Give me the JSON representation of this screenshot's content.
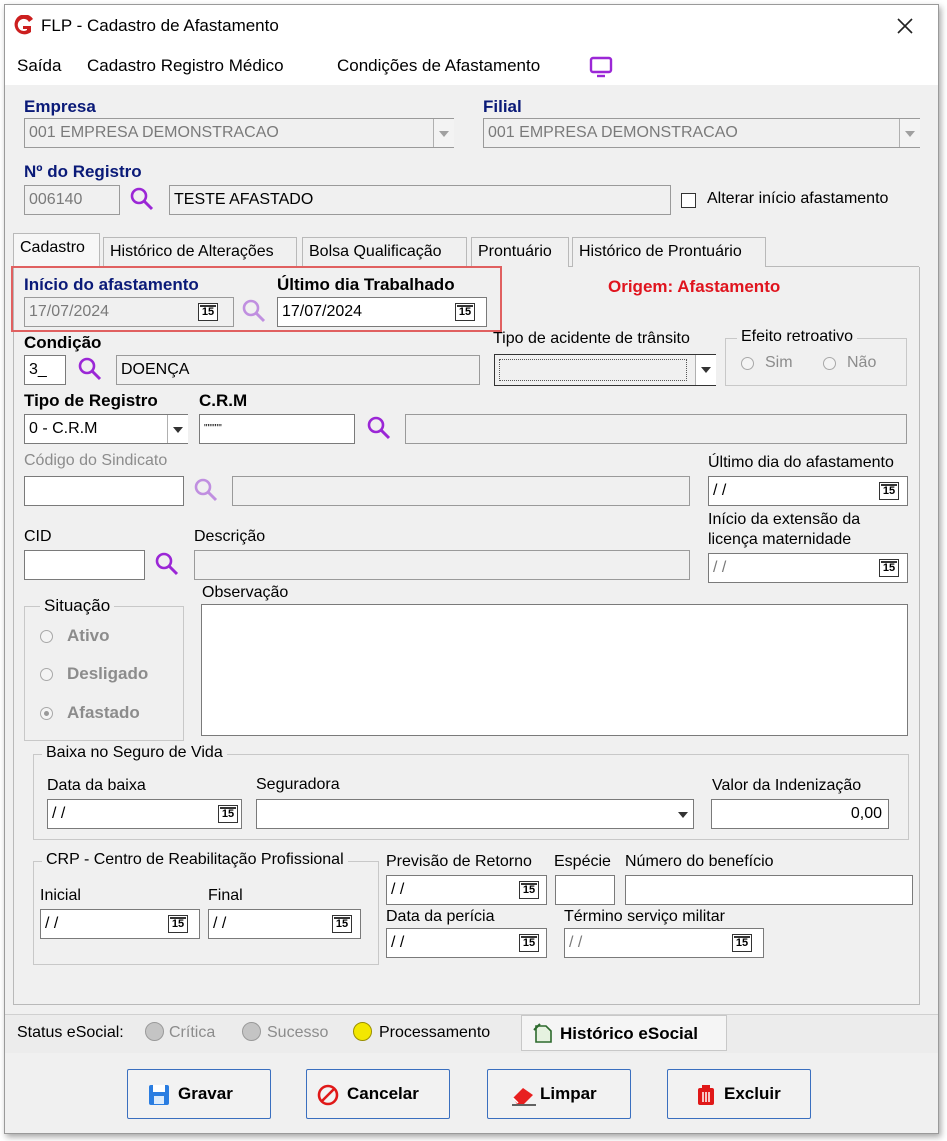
{
  "window": {
    "title": "FLP - Cadastro de Afastamento"
  },
  "menu": {
    "items": [
      "Saída",
      "Cadastro Registro Médico",
      "Condições de Afastamento"
    ]
  },
  "header": {
    "empresa_label": "Empresa",
    "empresa_value": "001 EMPRESA DEMONSTRACAO",
    "filial_label": "Filial",
    "filial_value": "001 EMPRESA DEMONSTRACAO",
    "registro_label": "Nº do Registro",
    "registro_number": "006140",
    "registro_name": "TESTE AFASTADO",
    "alterar_inicio_label": "Alterar início afastamento"
  },
  "tabs": [
    "Cadastro",
    "Histórico de Alterações",
    "Bolsa Qualificação",
    "Prontuário",
    "Histórico de Prontuário"
  ],
  "form": {
    "inicio_label": "Início do afastamento",
    "inicio_value": "17/07/2024",
    "ultimo_trab_label": "Último dia Trabalhado",
    "ultimo_trab_value": "17/07/2024",
    "origem_text": "Origem: Afastamento",
    "condicao_label": "Condição",
    "condicao_code": "3_",
    "condicao_desc": "DOENÇA",
    "tipo_acidente_label": "Tipo de acidente de trânsito",
    "efeito_label": "Efeito retroativo",
    "efeito_sim": "Sim",
    "efeito_nao": "Não",
    "tipo_registro_label": "Tipo de Registro",
    "tipo_registro_value": "0 - C.R.M",
    "crm_label": "C.R.M",
    "crm_value": "\"\"\"\"\"",
    "sindicato_label": "Código do Sindicato",
    "ultimo_afast_label": "Último dia do afastamento",
    "ultimo_afast_value": "/ /",
    "extensao_label_1": "Início da extensão da",
    "extensao_label_2": "licença maternidade",
    "extensao_value": "/ /",
    "cid_label": "CID",
    "descricao_label": "Descrição",
    "situacao_label": "Situação",
    "situacao_ativo": "Ativo",
    "situacao_desligado": "Desligado",
    "situacao_afastado": "Afastado",
    "observacao_label": "Observação",
    "calendar_icon_text": "15"
  },
  "seguro": {
    "group_label": "Baixa no Seguro de Vida",
    "data_baixa_label": "Data da baixa",
    "data_baixa_value": "/ /",
    "seguradora_label": "Seguradora",
    "valor_label": "Valor da Indenização",
    "valor_value": "0,00"
  },
  "crp": {
    "group_label": "CRP - Centro de Reabilitação Profissional",
    "inicial_label": "Inicial",
    "inicial_value": "/ /",
    "final_label": "Final",
    "final_value": "/ /",
    "previsao_label": "Previsão de Retorno",
    "previsao_value": "/ /",
    "especie_label": "Espécie",
    "numero_beneficio_label": "Número do benefício",
    "data_pericia_label": "Data da perícia",
    "data_pericia_value": "/ /",
    "termino_militar_label": "Término serviço militar",
    "termino_militar_value": "/ /"
  },
  "status_bar": {
    "label": "Status eSocial:",
    "critica": "Crítica",
    "sucesso": "Sucesso",
    "processamento": "Processamento",
    "historico_button": "Histórico eSocial"
  },
  "buttons": {
    "gravar": "Gravar",
    "cancelar": "Cancelar",
    "limpar": "Limpar",
    "excluir": "Excluir"
  },
  "colors": {
    "label_blue": "#0a1a78",
    "origem_red": "#e0141e",
    "highlight_red": "#e06060",
    "accent_purple": "#9b27d6",
    "status_yellow": "#f3e700"
  }
}
